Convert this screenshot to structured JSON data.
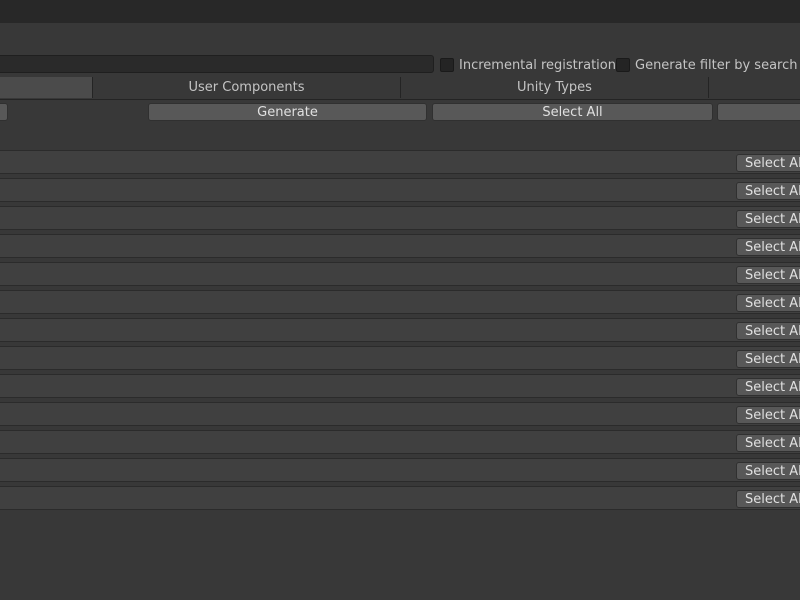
{
  "toolbar": {
    "incremental_label": "Incremental registration",
    "incremental_checked": false,
    "filter_label": "Generate filter by search",
    "filter_checked": false
  },
  "tabs": [
    {
      "label": ""
    },
    {
      "label": "User Components"
    },
    {
      "label": "Unity Types"
    },
    {
      "label": ""
    }
  ],
  "actions": {
    "generate_label": "Generate",
    "select_all_label": "Select All"
  },
  "rows": [
    {
      "button_label": "Select All"
    },
    {
      "button_label": "Select All"
    },
    {
      "button_label": "Select All"
    },
    {
      "button_label": "Select All"
    },
    {
      "button_label": "Select All"
    },
    {
      "button_label": "Select All"
    },
    {
      "button_label": "Select All"
    },
    {
      "button_label": "Select All"
    },
    {
      "button_label": "Select All"
    },
    {
      "button_label": "Select All"
    },
    {
      "button_label": "Select All"
    },
    {
      "button_label": "Select All"
    },
    {
      "button_label": "Select All"
    }
  ]
}
